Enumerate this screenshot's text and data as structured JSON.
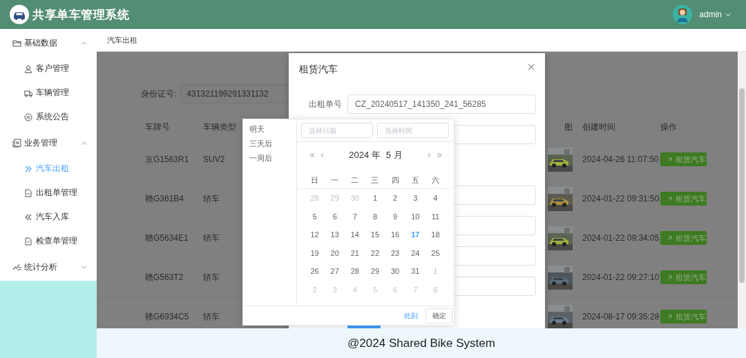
{
  "header": {
    "title": "共享单车管理系统",
    "user": "admin"
  },
  "sidebar": {
    "groups": [
      {
        "label": "基础数据",
        "expanded": true,
        "items": [
          {
            "label": "客户管理",
            "selected": false
          },
          {
            "label": "车辆管理",
            "selected": false
          },
          {
            "label": "系统公告",
            "selected": false
          }
        ]
      },
      {
        "label": "业务管理",
        "expanded": true,
        "items": [
          {
            "label": "汽车出租",
            "selected": true
          },
          {
            "label": "出租单管理",
            "selected": false
          },
          {
            "label": "汽车入库",
            "selected": false
          },
          {
            "label": "检查单管理",
            "selected": false
          }
        ]
      },
      {
        "label": "统计分析",
        "expanded": false
      }
    ]
  },
  "breadcrumb": "汽车出租",
  "search": {
    "label": "身份证号:",
    "value": "431321199291331132"
  },
  "table": {
    "columns": [
      "车牌号",
      "车辆类型",
      "图",
      "创建时间",
      "操作"
    ],
    "rows": [
      {
        "plate": "京G1563R1",
        "type": "SUV2",
        "created": "2024-04-26 11:07:50",
        "action": "租赁汽车"
      },
      {
        "plate": "赣G361B4",
        "type": "轿车",
        "created": "2024-01-22 09:31:50",
        "action": "租赁汽车"
      },
      {
        "plate": "赣G5634E1",
        "type": "轿车",
        "created": "2024-01-22 09:34:05",
        "action": "租赁汽车"
      },
      {
        "plate": "赣G563T2",
        "type": "轿车",
        "created": "2024-01-22 09:27:10",
        "action": "租赁汽车"
      },
      {
        "plate": "赣G6934C5",
        "type": "轿车",
        "created": "2024-08-17 09:35:28",
        "action": "租赁汽车"
      }
    ]
  },
  "dialog": {
    "title": "租赁汽车",
    "fields": [
      {
        "kind": "input",
        "label": "出租单号",
        "value": "CZ_20240517_141350_241_56285"
      },
      {
        "kind": "input"
      },
      {
        "kind": "input"
      },
      {
        "kind": "input"
      },
      {
        "kind": "input"
      },
      {
        "kind": "input"
      }
    ]
  },
  "date_picker": {
    "shortcuts": [
      "明天",
      "三天后",
      "一周后"
    ],
    "date_placeholder": "选择日期",
    "time_placeholder": "选择时间",
    "year": "2024 年",
    "month": "5 月",
    "weekdays": [
      "日",
      "一",
      "二",
      "三",
      "四",
      "五",
      "六"
    ],
    "days": [
      {
        "day": "28",
        "muted": true,
        "today": false
      },
      {
        "day": "29",
        "muted": true,
        "today": false
      },
      {
        "day": "30",
        "muted": true,
        "today": false
      },
      {
        "day": "1",
        "muted": false,
        "today": false
      },
      {
        "day": "2",
        "muted": false,
        "today": false
      },
      {
        "day": "3",
        "muted": false,
        "today": false
      },
      {
        "day": "4",
        "muted": false,
        "today": false
      },
      {
        "day": "5",
        "muted": false,
        "today": false
      },
      {
        "day": "6",
        "muted": false,
        "today": false
      },
      {
        "day": "7",
        "muted": false,
        "today": false
      },
      {
        "day": "8",
        "muted": false,
        "today": false
      },
      {
        "day": "9",
        "muted": false,
        "today": false
      },
      {
        "day": "10",
        "muted": false,
        "today": false
      },
      {
        "day": "11",
        "muted": false,
        "today": false
      },
      {
        "day": "12",
        "muted": false,
        "today": false
      },
      {
        "day": "13",
        "muted": false,
        "today": false
      },
      {
        "day": "14",
        "muted": false,
        "today": false
      },
      {
        "day": "15",
        "muted": false,
        "today": false
      },
      {
        "day": "16",
        "muted": false,
        "today": false
      },
      {
        "day": "17",
        "muted": false,
        "today": true
      },
      {
        "day": "18",
        "muted": false,
        "today": false
      },
      {
        "day": "19",
        "muted": false,
        "today": false
      },
      {
        "day": "20",
        "muted": false,
        "today": false
      },
      {
        "day": "21",
        "muted": false,
        "today": false
      },
      {
        "day": "22",
        "muted": false,
        "today": false
      },
      {
        "day": "23",
        "muted": false,
        "today": false
      },
      {
        "day": "24",
        "muted": false,
        "today": false
      },
      {
        "day": "25",
        "muted": false,
        "today": false
      },
      {
        "day": "26",
        "muted": false,
        "today": false
      },
      {
        "day": "27",
        "muted": false,
        "today": false
      },
      {
        "day": "28",
        "muted": false,
        "today": false
      },
      {
        "day": "29",
        "muted": false,
        "today": false
      },
      {
        "day": "30",
        "muted": false,
        "today": false
      },
      {
        "day": "31",
        "muted": false,
        "today": false
      },
      {
        "day": "1",
        "muted": true,
        "today": false
      },
      {
        "day": "2",
        "muted": true,
        "today": false
      },
      {
        "day": "3",
        "muted": true,
        "today": false
      },
      {
        "day": "4",
        "muted": true,
        "today": false
      },
      {
        "day": "5",
        "muted": true,
        "today": false
      },
      {
        "day": "6",
        "muted": true,
        "today": false
      },
      {
        "day": "7",
        "muted": true,
        "today": false
      },
      {
        "day": "8",
        "muted": true,
        "today": false
      }
    ],
    "now_link": "此刻",
    "confirm": "确定"
  },
  "footer": "@2024 Shared Bike System"
}
